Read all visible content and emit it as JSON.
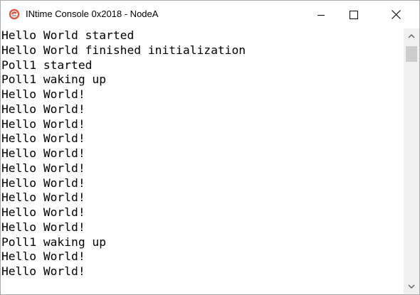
{
  "window": {
    "title": "INtime Console 0x2018 - NodeA"
  },
  "icons": {
    "app": "intime-app-icon",
    "minimize": "minimize-icon",
    "maximize": "maximize-icon",
    "close": "close-icon",
    "scroll_up": "chevron-up-icon",
    "scroll_down": "chevron-down-icon"
  },
  "colors": {
    "app_icon_accent": "#e2513b",
    "scroll_thumb": "#cdcdcd",
    "scroll_track": "#f0f0f0"
  },
  "console": {
    "lines": [
      "Hello World started",
      "Hello World finished initialization",
      "Poll1 started",
      "Poll1 waking up",
      "Hello World!",
      "Hello World!",
      "Hello World!",
      "Hello World!",
      "Hello World!",
      "Hello World!",
      "Hello World!",
      "Hello World!",
      "Hello World!",
      "Hello World!",
      "Poll1 waking up",
      "Hello World!",
      "Hello World!"
    ]
  }
}
